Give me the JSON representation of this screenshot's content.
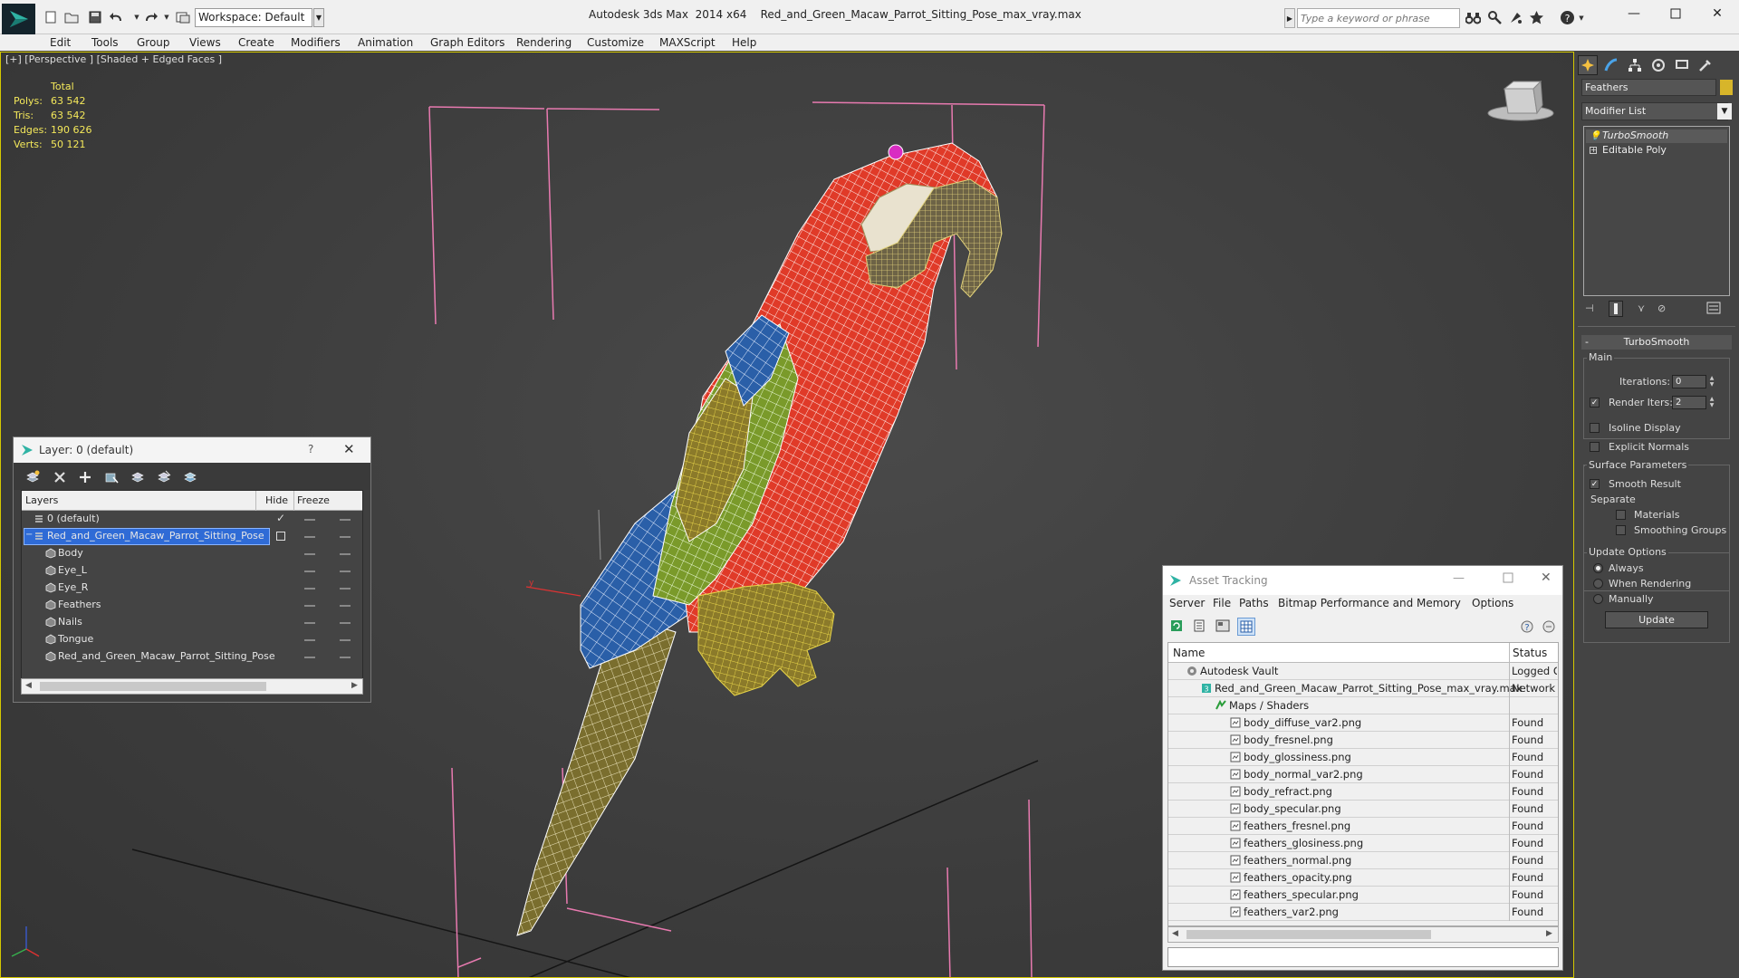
{
  "titlebar": {
    "workspace": "Workspace: Default",
    "app_name": "Autodesk 3ds Max  2014 x64",
    "file_name": "Red_and_Green_Macaw_Parrot_Sitting_Pose_max_vray.max",
    "search_placeholder": "Type a keyword or phrase"
  },
  "menu": [
    "Edit",
    "Tools",
    "Group",
    "Views",
    "Create",
    "Modifiers",
    "Animation",
    "Graph Editors",
    "Rendering",
    "Customize",
    "MAXScript",
    "Help"
  ],
  "viewport": {
    "label": "[+] [Perspective ] [Shaded + Edged Faces ]",
    "stats": {
      "header": "Total",
      "rows": [
        {
          "label": "Polys:",
          "value": "63 542"
        },
        {
          "label": "Tris:",
          "value": "63 542"
        },
        {
          "label": "Edges:",
          "value": "190 626"
        },
        {
          "label": "Verts:",
          "value": "50 121"
        }
      ]
    },
    "axis_label": "y"
  },
  "layer_window": {
    "title": "Layer: 0 (default)",
    "help": "?",
    "columns": {
      "layers": "Layers",
      "hide": "Hide",
      "freeze": "Freeze"
    },
    "rows": [
      {
        "name": "0 (default)",
        "level": 0,
        "type": "layer",
        "current": true
      },
      {
        "name": "Red_and_Green_Macaw_Parrot_Sitting_Pose",
        "level": 0,
        "type": "layer",
        "selected": true
      },
      {
        "name": "Body",
        "level": 1,
        "type": "object"
      },
      {
        "name": "Eye_L",
        "level": 1,
        "type": "object"
      },
      {
        "name": "Eye_R",
        "level": 1,
        "type": "object"
      },
      {
        "name": "Feathers",
        "level": 1,
        "type": "object"
      },
      {
        "name": "Nails",
        "level": 1,
        "type": "object"
      },
      {
        "name": "Tongue",
        "level": 1,
        "type": "object"
      },
      {
        "name": "Red_and_Green_Macaw_Parrot_Sitting_Pose",
        "level": 1,
        "type": "object"
      }
    ]
  },
  "asset_window": {
    "title": "Asset Tracking",
    "menu": [
      "Server",
      "File",
      "Paths",
      "Bitmap Performance and Memory",
      "Options"
    ],
    "columns": {
      "name": "Name",
      "status": "Status"
    },
    "rows": [
      {
        "name": "Autodesk Vault",
        "status": "Logged Out",
        "level": 0,
        "icon": "vault"
      },
      {
        "name": "Red_and_Green_Macaw_Parrot_Sitting_Pose_max_vray.max",
        "status": "Network Path",
        "level": 1,
        "icon": "max"
      },
      {
        "name": "Maps / Shaders",
        "status": "",
        "level": 2,
        "icon": "maps"
      },
      {
        "name": "body_diffuse_var2.png",
        "status": "Found",
        "level": 3,
        "icon": "file"
      },
      {
        "name": "body_fresnel.png",
        "status": "Found",
        "level": 3,
        "icon": "file"
      },
      {
        "name": "body_glossiness.png",
        "status": "Found",
        "level": 3,
        "icon": "file"
      },
      {
        "name": "body_normal_var2.png",
        "status": "Found",
        "level": 3,
        "icon": "file"
      },
      {
        "name": "body_refract.png",
        "status": "Found",
        "level": 3,
        "icon": "file"
      },
      {
        "name": "body_specular.png",
        "status": "Found",
        "level": 3,
        "icon": "file"
      },
      {
        "name": "feathers_fresnel.png",
        "status": "Found",
        "level": 3,
        "icon": "file"
      },
      {
        "name": "feathers_glosiness.png",
        "status": "Found",
        "level": 3,
        "icon": "file"
      },
      {
        "name": "feathers_normal.png",
        "status": "Found",
        "level": 3,
        "icon": "file"
      },
      {
        "name": "feathers_opacity.png",
        "status": "Found",
        "level": 3,
        "icon": "file"
      },
      {
        "name": "feathers_specular.png",
        "status": "Found",
        "level": 3,
        "icon": "file"
      },
      {
        "name": "feathers_var2.png",
        "status": "Found",
        "level": 3,
        "icon": "file"
      }
    ]
  },
  "command_panel": {
    "object_name": "Feathers",
    "object_color": "#d7b52a",
    "modifier_list": "Modifier List",
    "stack": [
      "TurboSmooth",
      "Editable Poly"
    ],
    "rollout": "TurboSmooth",
    "main_group": "Main",
    "iterations_label": "Iterations:",
    "iterations_value": "0",
    "render_iters_label": "Render Iters:",
    "render_iters_value": "2",
    "render_iters_checked": true,
    "isoline": "Isoline Display",
    "explicit_normals": "Explicit Normals",
    "surface_group": "Surface Parameters",
    "smooth_result": "Smooth Result",
    "separate": "Separate",
    "materials": "Materials",
    "smoothing_groups": "Smoothing Groups",
    "update_group": "Update Options",
    "always": "Always",
    "when_rendering": "When Rendering",
    "manually": "Manually",
    "update_btn": "Update"
  },
  "colors": {
    "viewport_bg": "#3f3f3f",
    "selection": "#2f6bd6",
    "wire_red": "#e03a28",
    "wire_yellow": "#c9b23a",
    "bbox": "#e87ab0"
  }
}
